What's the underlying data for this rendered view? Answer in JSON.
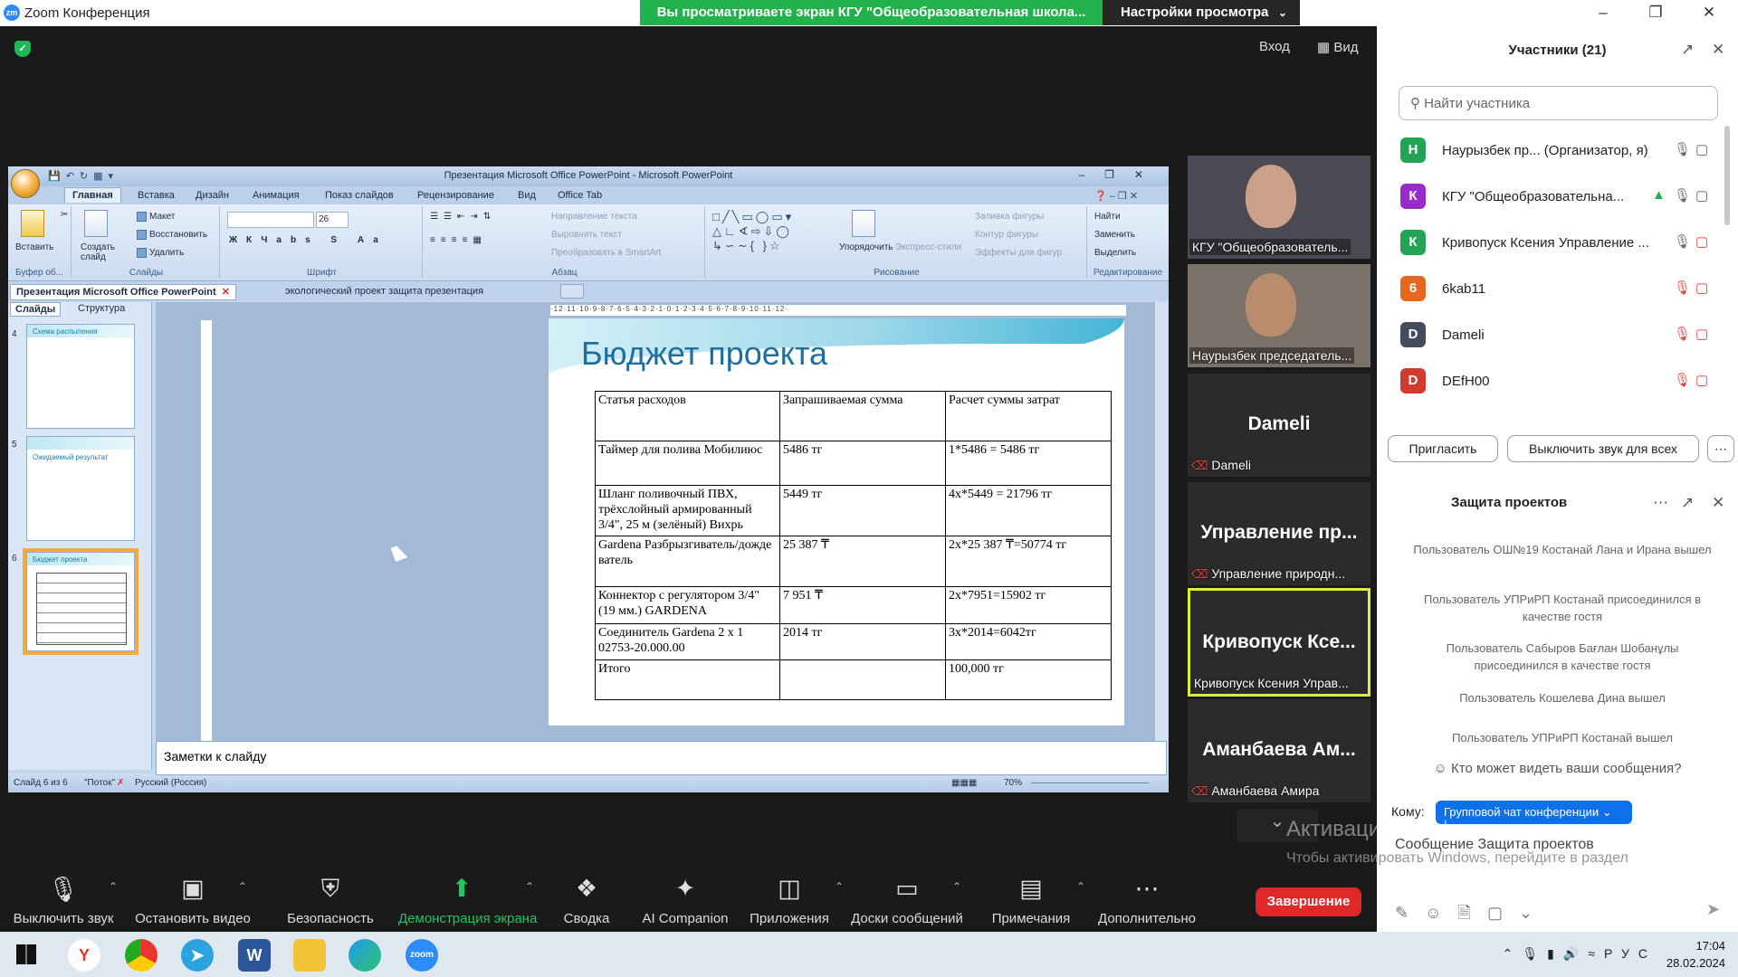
{
  "window": {
    "title": "Zoom Конференция",
    "app_logo": "zm"
  },
  "share_banner": "Вы просматриваете экран КГУ \"Общеобразовательная школа...",
  "view_settings": "Настройки просмотра",
  "top_controls": {
    "enter": "Вход",
    "view": "Вид"
  },
  "ppt": {
    "title": "Презентация Microsoft Office PowerPoint - Microsoft PowerPoint",
    "tabs": [
      "Главная",
      "Вставка",
      "Дизайн",
      "Анимация",
      "Показ слайдов",
      "Рецензирование",
      "Вид",
      "Office Tab"
    ],
    "ribbon": {
      "clipboard": {
        "paste": "Вставить",
        "label": "Буфер об..."
      },
      "slides": {
        "create": "Создать слайд",
        "layout": "Макет",
        "restore": "Восстановить",
        "delete": "Удалить",
        "label": "Слайды"
      },
      "font": {
        "size": "26",
        "label": "Шрифт"
      },
      "paragraph": {
        "text_dir": "Направление текста",
        "align_text": "Выровнять текст",
        "smartart": "Преобразовать в SmartArt",
        "label": "Абзац"
      },
      "drawing": {
        "arrange": "Упорядочить",
        "express": "Экспресс-стили",
        "fill": "Заливка фигуры",
        "outline": "Контур фигуры",
        "effects": "Эффекты для фигур",
        "label": "Рисование"
      },
      "editing": {
        "find": "Найти",
        "replace": "Заменить",
        "select": "Выделить",
        "label": "Редактирование"
      }
    },
    "doc_tabs": [
      "Презентация Microsoft Office PowerPoint",
      "экологический проект защита презентация"
    ],
    "panel_tabs": [
      "Слайды",
      "Структура"
    ],
    "thumbs": [
      {
        "num": "4",
        "title": "Схема распыления"
      },
      {
        "num": "5",
        "title": "Ожидаемый результат"
      },
      {
        "num": "6",
        "title": "Бюджет проекта"
      }
    ],
    "ruler": "·12·11·10·9·8·7·6·5·4·3·2·1·0·1·2·3·4·5·6·7·8·9·10·11·12·",
    "slide_title": "Бюджет проекта",
    "table": {
      "headers": [
        "Статья расходов",
        "Запрашиваемая сумма",
        "Расчет суммы затрат"
      ],
      "rows": [
        [
          "Таймер для полива Мобилиюс",
          "5486 тг",
          "1*5486 = 5486 тг"
        ],
        [
          "Шланг поливочный ПВХ, трёхслойный армированный 3/4\", 25 м (зелёный) Вихрь",
          "5449 тг",
          "4х*5449 = 21796 тг"
        ],
        [
          "Gardena Разбрызгиватель/дождеватель",
          "25 387 ₸",
          "2х*25 387 ₸=50774 тг"
        ],
        [
          "Коннектор с регулятором 3/4\" (19 мм.) GARDENA",
          "7 951 ₸",
          "2х*7951=15902 тг"
        ],
        [
          "Соединитель Gardena 2 x 1 02753-20.000.00",
          "2014 тг",
          "3х*2014=6042тг"
        ],
        [
          "Итого",
          "",
          "100,000 тг"
        ]
      ]
    },
    "notes": "Заметки к слайду",
    "status": {
      "slide": "Слайд 6 из 6",
      "theme": "\"Поток\"",
      "lang": "Русский (Россия)",
      "zoom": "70%"
    }
  },
  "videos": [
    {
      "name": "КГУ \"Общеобразователь...",
      "big": ""
    },
    {
      "name": "Наурызбек председатель...",
      "big": ""
    },
    {
      "name": "Dameli",
      "big": "Dameli"
    },
    {
      "name": "Управление природн...",
      "big": "Управление пр..."
    },
    {
      "name": "Кривопуск Ксения Управ...",
      "big": "Кривопуск Ксе..."
    },
    {
      "name": "Аманбаева Амира",
      "big": "Аманбаева Ам..."
    }
  ],
  "participants": {
    "header": "Участники (21)",
    "search_placeholder": "Найти участника",
    "list": [
      {
        "initial": "Н",
        "color": "#23a455",
        "name": "Наурызбек пр...  (Организатор, я)"
      },
      {
        "initial": "К",
        "color": "#9b2bc9",
        "name": "КГУ \"Общеобразовательна..."
      },
      {
        "initial": "К",
        "color": "#23a455",
        "name": "Кривопуск Ксения Управление ..."
      },
      {
        "initial": "6",
        "color": "#e8671f",
        "name": "6kab11"
      },
      {
        "initial": "D",
        "color": "#444c5c",
        "name": "Dameli"
      },
      {
        "initial": "D",
        "color": "#d23a2e",
        "name": "DEfH00"
      }
    ],
    "invite": "Пригласить",
    "mute_all": "Выключить звук для всех"
  },
  "chat": {
    "header": "Защита проектов",
    "messages": [
      "Пользователь ОШ№19 Костанай Лана и Ирана вышел",
      "Пользователь УПРиРП Костанай присоединился в качестве гостя",
      "Пользователь Сабыров Бағлан Шобанұлы присоединился в качестве гостя",
      "Пользователь Кошелева Дина вышел",
      "Пользователь УПРиРП Костанай вышел"
    ],
    "who_can_see": "Кто может видеть ваши сообщения?",
    "to_label": "Кому:",
    "to_value": "Групповой чат конференции",
    "input": "Сообщение Защита проектов"
  },
  "activation": {
    "title": "Активация Windows",
    "text": "Чтобы активировать Windows, перейдите в раздел \"Параметры\"."
  },
  "toolbar": [
    {
      "label": "Выключить звук",
      "icon": "microphone-icon"
    },
    {
      "label": "Остановить видео",
      "icon": "video-camera-icon"
    },
    {
      "label": "Безопасность",
      "icon": "shield-icon"
    },
    {
      "label": "Демонстрация экрана",
      "icon": "share-screen-icon"
    },
    {
      "label": "Сводка",
      "icon": "summary-icon"
    },
    {
      "label": "AI Companion",
      "icon": "sparkle-icon"
    },
    {
      "label": "Приложения",
      "icon": "apps-icon"
    },
    {
      "label": "Доски сообщений",
      "icon": "whiteboard-icon"
    },
    {
      "label": "Примечания",
      "icon": "notes-icon"
    },
    {
      "label": "Дополнительно",
      "icon": "more-icon"
    }
  ],
  "end_button": "Завершение",
  "taskbar": {
    "lang": "РУС",
    "time": "17:04",
    "date": "28.02.2024"
  },
  "colors": {
    "zoom_green": "#22b24c",
    "zoom_blue": "#0e71eb",
    "end_red": "#e02828",
    "active_speaker": "#d9ef39"
  }
}
